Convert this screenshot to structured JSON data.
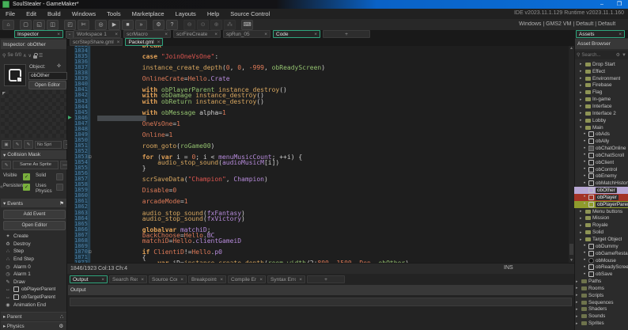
{
  "window": {
    "title": "SoulStealer - GameMaker*",
    "minimize": "–",
    "maximize": "❐"
  },
  "menu": {
    "items": [
      "File",
      "Edit",
      "Build",
      "Windows",
      "Tools",
      "Marketplace",
      "Layouts",
      "Help",
      "Source Control"
    ],
    "version_text": "IDE v2023.11.1.129 Runtime v2023.11.1.160"
  },
  "toolbar": {
    "target_text": "Windows | GMS2 VM | Default | Default",
    "glyphs": {
      "home": "⌂",
      "new": "▢",
      "open": "◱",
      "save": "◫",
      "package": "◰",
      "clean": "✄",
      "debug": "◎",
      "run": "▶",
      "stop": "■",
      "forward": "»",
      "settings": "⚙",
      "help": "?",
      "zoom-out": "⊖",
      "zoom-reset": "⊙",
      "zoom-in": "⊕",
      "paw": "⁂",
      "laptop": "⌨"
    },
    "groups": [
      {
        "dim": false,
        "icons": [
          "home"
        ]
      },
      {
        "dim": false,
        "icons": [
          "new",
          "open",
          "save"
        ]
      },
      {
        "dim": false,
        "icons": [
          "package",
          "clean"
        ]
      },
      {
        "dim": false,
        "icons": [
          "debug",
          "run",
          "stop",
          "forward"
        ]
      },
      {
        "dim": false,
        "icons": [
          "settings",
          "help"
        ]
      },
      {
        "dim": true,
        "icons": [
          "zoom-out",
          "zoom-reset",
          "zoom-in",
          "paw"
        ]
      },
      {
        "dim": false,
        "icons": [
          "laptop"
        ]
      }
    ]
  },
  "workspace_tabs": [
    {
      "label": "Workspace 1",
      "active": false
    },
    {
      "label": "scrMacro",
      "active": false
    },
    {
      "label": "scrFireCreate",
      "active": false
    },
    {
      "label": "spRun_05",
      "active": false
    },
    {
      "label": "Code",
      "active": true
    }
  ],
  "inspector": {
    "tab_label": "Inspector",
    "header": "Inspector: obOther",
    "search": {
      "icon": "⚲",
      "label": "Se",
      "count": "0/0",
      "up": "∧",
      "down": "∨",
      "menu": "☰"
    },
    "object": {
      "label": "Object:",
      "pin": "✜",
      "name": "obOther",
      "open_editor": "Open Editor"
    },
    "sprite_row": {
      "value": "No Spri",
      "more": "—"
    },
    "collision": {
      "title": "Collision Mask",
      "edit": "✎",
      "same_as": "Same As Sprite",
      "more": "—",
      "checkboxes": [
        {
          "label": "Visible",
          "checked": true
        },
        {
          "label": "Solid",
          "checked": false
        },
        {
          "label": "Persistent",
          "checked": true
        },
        {
          "label": "Uses Physics",
          "checked": false
        }
      ]
    },
    "events": {
      "title": "Events",
      "flag": "⚑",
      "add_button": "Add Event",
      "open_button": "Open Editor",
      "glyphs": {
        "create": "✦",
        "destroy": "♻",
        "step": "∴",
        "alarm": "◷",
        "draw": "✎",
        "collision": "↔",
        "animend": "◉"
      },
      "list": [
        {
          "icon": "create",
          "label": "Create"
        },
        {
          "icon": "destroy",
          "label": "Destroy"
        },
        {
          "icon": "step",
          "label": "Step"
        },
        {
          "icon": "step",
          "label": "End Step"
        },
        {
          "icon": "alarm",
          "label": "Alarm 0"
        },
        {
          "icon": "alarm",
          "label": "Alarm 1"
        },
        {
          "icon": "draw",
          "label": "Draw"
        },
        {
          "icon": "collision",
          "label": "obPlayerParent",
          "obj": true
        },
        {
          "icon": "collision",
          "label": "obTargetParent",
          "obj": true
        },
        {
          "icon": "animend",
          "label": "Animation End"
        }
      ]
    },
    "sections": [
      {
        "label": "Parent",
        "icon": "∴"
      },
      {
        "label": "Physics",
        "icon": "⚙"
      }
    ],
    "collapse_glyph": "«"
  },
  "editor": {
    "file_tabs": [
      {
        "label": "scrStepShare.gml",
        "active": false
      },
      {
        "label": "Packet.gml",
        "active": true
      }
    ],
    "status_left": "1846/1923 Col:13 Ch:4",
    "status_right": "INS",
    "exec_marker": "▶",
    "fold_glyph": "⊟",
    "lines": [
      {
        "n": "1833",
        "seg": [
          [
            "k",
            "            break"
          ]
        ]
      },
      {
        "n": "1834",
        "seg": []
      },
      {
        "n": "1835",
        "seg": [
          [
            "k",
            "            case "
          ],
          [
            "s",
            "\"JoinOneVsOne\""
          ],
          [
            "w",
            ":"
          ]
        ]
      },
      {
        "n": "1836",
        "seg": []
      },
      {
        "n": "1837",
        "seg": [
          [
            "f",
            "            instance_create_depth"
          ],
          [
            "w",
            "("
          ],
          [
            "n",
            "0"
          ],
          [
            "w",
            ", "
          ],
          [
            "n",
            "0"
          ],
          [
            "w",
            ", "
          ],
          [
            "n",
            "-999"
          ],
          [
            "w",
            ", "
          ],
          [
            "o",
            "obReadyScreen"
          ],
          [
            "w",
            ")"
          ]
        ]
      },
      {
        "n": "1838",
        "seg": []
      },
      {
        "n": "1839",
        "seg": [
          [
            "g",
            "            OnlineCrate"
          ],
          [
            "w",
            "="
          ],
          [
            "g",
            "Hello"
          ],
          [
            "w",
            "."
          ],
          [
            "v",
            "Crate"
          ]
        ]
      },
      {
        "n": "1840",
        "seg": []
      },
      {
        "n": "1841",
        "seg": [
          [
            "k",
            "            with "
          ],
          [
            "o",
            "obPlayerParent"
          ],
          [
            "w",
            " "
          ],
          [
            "f",
            "instance_destroy"
          ],
          [
            "w",
            "()"
          ]
        ]
      },
      {
        "n": "1842",
        "seg": [
          [
            "k",
            "            with "
          ],
          [
            "o",
            "obDamage"
          ],
          [
            "w",
            " "
          ],
          [
            "f",
            "instance_destroy"
          ],
          [
            "w",
            "()"
          ]
        ]
      },
      {
        "n": "1843",
        "seg": [
          [
            "k",
            "            with "
          ],
          [
            "o",
            "obReturn"
          ],
          [
            "w",
            " "
          ],
          [
            "f",
            "instance_destroy"
          ],
          [
            "w",
            "()"
          ]
        ]
      },
      {
        "n": "1844",
        "seg": []
      },
      {
        "n": "1845",
        "seg": [
          [
            "k",
            "            with "
          ],
          [
            "o",
            "obMessage"
          ],
          [
            "w",
            " alpha="
          ],
          [
            "n",
            "1"
          ]
        ]
      },
      {
        "n": "1846",
        "caret": true,
        "seg": []
      },
      {
        "n": "1847",
        "seg": [
          [
            "g",
            "            OneVsOne"
          ],
          [
            "w",
            "="
          ],
          [
            "n",
            "1"
          ]
        ]
      },
      {
        "n": "1848",
        "seg": []
      },
      {
        "n": "1849",
        "seg": [
          [
            "g",
            "            Online"
          ],
          [
            "w",
            "="
          ],
          [
            "n",
            "1"
          ]
        ]
      },
      {
        "n": "1850",
        "seg": []
      },
      {
        "n": "1851",
        "seg": [
          [
            "f",
            "            room_goto"
          ],
          [
            "w",
            "("
          ],
          [
            "o",
            "roGame00"
          ],
          [
            "w",
            ")"
          ]
        ]
      },
      {
        "n": "1852",
        "seg": []
      },
      {
        "n": "1853",
        "fold": true,
        "seg": [
          [
            "k",
            "            for "
          ],
          [
            "w",
            "("
          ],
          [
            "k",
            "var"
          ],
          [
            "w",
            " i = "
          ],
          [
            "n",
            "0"
          ],
          [
            "w",
            "; i < "
          ],
          [
            "v",
            "menuMusicCount"
          ],
          [
            "w",
            "; ++i) {"
          ]
        ]
      },
      {
        "n": "1854",
        "seg": [
          [
            "f",
            "                audio_stop_sound"
          ],
          [
            "w",
            "("
          ],
          [
            "v",
            "audioMusicM"
          ],
          [
            "w",
            "[i])"
          ]
        ]
      },
      {
        "n": "1855",
        "seg": [
          [
            "w",
            "            }"
          ]
        ]
      },
      {
        "n": "1856",
        "seg": []
      },
      {
        "n": "1857",
        "seg": [
          [
            "f",
            "            scrSaveData"
          ],
          [
            "w",
            "("
          ],
          [
            "s",
            "\"Champion\""
          ],
          [
            "w",
            ", "
          ],
          [
            "v",
            "Champion"
          ],
          [
            "w",
            ")"
          ]
        ]
      },
      {
        "n": "1858",
        "seg": []
      },
      {
        "n": "1859",
        "seg": [
          [
            "g",
            "            Disable"
          ],
          [
            "w",
            "="
          ],
          [
            "n",
            "0"
          ]
        ]
      },
      {
        "n": "1860",
        "seg": []
      },
      {
        "n": "1861",
        "seg": [
          [
            "g",
            "            arcadeMode"
          ],
          [
            "w",
            "="
          ],
          [
            "n",
            "1"
          ]
        ]
      },
      {
        "n": "1862",
        "seg": []
      },
      {
        "n": "1863",
        "seg": [
          [
            "f",
            "            audio_stop_sound"
          ],
          [
            "w",
            "("
          ],
          [
            "v",
            "fxFantasy"
          ],
          [
            "w",
            ")"
          ]
        ]
      },
      {
        "n": "1864",
        "seg": [
          [
            "f",
            "            audio_stop_sound"
          ],
          [
            "w",
            "("
          ],
          [
            "v",
            "fxVictory"
          ],
          [
            "w",
            ")"
          ]
        ]
      },
      {
        "n": "1865",
        "seg": []
      },
      {
        "n": "1866",
        "seg": [
          [
            "k",
            "            globalvar "
          ],
          [
            "v",
            "matchiD"
          ],
          [
            "w",
            ";"
          ]
        ]
      },
      {
        "n": "1867",
        "seg": [
          [
            "g",
            "            backChoose"
          ],
          [
            "w",
            "="
          ],
          [
            "g",
            "Hello"
          ],
          [
            "w",
            "."
          ],
          [
            "v",
            "BC"
          ]
        ]
      },
      {
        "n": "1868",
        "seg": [
          [
            "g",
            "            matchiD"
          ],
          [
            "w",
            "="
          ],
          [
            "g",
            "Hello"
          ],
          [
            "w",
            "."
          ],
          [
            "v",
            "clientGameiD"
          ]
        ]
      },
      {
        "n": "1869",
        "seg": []
      },
      {
        "n": "1870",
        "fold": true,
        "seg": [
          [
            "k",
            "            if "
          ],
          [
            "g",
            "ClientiD"
          ],
          [
            "w",
            "!="
          ],
          [
            "g",
            "Hello"
          ],
          [
            "w",
            "."
          ],
          [
            "v",
            "p0"
          ]
        ]
      },
      {
        "n": "1871",
        "seg": [
          [
            "w",
            "            {"
          ]
        ]
      },
      {
        "n": "1872",
        "seg": [
          [
            "k",
            "                var "
          ],
          [
            "w",
            "iD="
          ],
          [
            "f",
            "instance_create_depth"
          ],
          [
            "w",
            "("
          ],
          [
            "o",
            "room_width"
          ],
          [
            "w",
            "/2+"
          ],
          [
            "n",
            "800"
          ],
          [
            "w",
            ", "
          ],
          [
            "n",
            "1500"
          ],
          [
            "w",
            ", "
          ],
          [
            "g",
            "Dep"
          ],
          [
            "w",
            ", "
          ],
          [
            "o",
            "obOther"
          ],
          [
            "w",
            ")"
          ]
        ]
      }
    ]
  },
  "output": {
    "tabs": [
      {
        "label": "Output",
        "active": true
      },
      {
        "label": "Search Results",
        "active": false
      },
      {
        "label": "Source Control",
        "active": false
      },
      {
        "label": "Breakpoints",
        "active": false
      },
      {
        "label": "Compile Errors",
        "active": false
      },
      {
        "label": "Syntax Errors",
        "active": false
      }
    ],
    "header": "Output"
  },
  "assets": {
    "tab_label": "Assets",
    "header": "Asset Browser",
    "search": {
      "icon": "⚲",
      "placeholder": "Search...",
      "gear": "⚙",
      "filter": "▼"
    },
    "tree": [
      {
        "label": "Drop Start",
        "ind": 1,
        "type": "folder",
        "arrow": "▸"
      },
      {
        "label": "Effect",
        "ind": 1,
        "type": "folder",
        "arrow": "▸"
      },
      {
        "label": "Environment",
        "ind": 1,
        "type": "folder",
        "arrow": "▸"
      },
      {
        "label": "Firebase",
        "ind": 1,
        "type": "folder",
        "arrow": "▸"
      },
      {
        "label": "Flag",
        "ind": 1,
        "type": "folder",
        "arrow": "▸"
      },
      {
        "label": "In-game",
        "ind": 1,
        "type": "folder",
        "arrow": "▸"
      },
      {
        "label": "Interface",
        "ind": 1,
        "type": "folder",
        "arrow": "▸"
      },
      {
        "label": "Interface 2",
        "ind": 1,
        "type": "folder",
        "arrow": "▸"
      },
      {
        "label": "Lobby",
        "ind": 1,
        "type": "folder",
        "arrow": "▸"
      },
      {
        "label": "Main",
        "ind": 1,
        "type": "folder",
        "arrow": "▾"
      },
      {
        "label": "obAds",
        "ind": 2,
        "type": "obj",
        "bullet": true
      },
      {
        "label": "obAlly",
        "ind": 2,
        "type": "obj",
        "bullet": true
      },
      {
        "label": "obChatOnline",
        "ind": 2,
        "type": "script",
        "bullet": true
      },
      {
        "label": "obChatScroll",
        "ind": 2,
        "type": "obj",
        "bullet": true
      },
      {
        "label": "obClient",
        "ind": 2,
        "type": "obj",
        "bullet": true
      },
      {
        "label": "obControl",
        "ind": 2,
        "type": "obj",
        "bullet": true
      },
      {
        "label": "obEnemy",
        "ind": 2,
        "type": "obj",
        "bullet": true
      },
      {
        "label": "obMatchHistory",
        "ind": 2,
        "type": "obj",
        "bullet": true
      },
      {
        "label": "obOther",
        "ind": 2,
        "type": "obj",
        "bullet": true,
        "hl": "purple"
      },
      {
        "label": "obPlayer",
        "ind": 2,
        "type": "obj",
        "bullet": true,
        "hl": "red"
      },
      {
        "label": "obPlayerParent",
        "ind": 2,
        "type": "obj",
        "bullet": true,
        "hl": "olive"
      },
      {
        "label": "Menu buttons",
        "ind": 1,
        "type": "folder",
        "arrow": "▸"
      },
      {
        "label": "Mission",
        "ind": 1,
        "type": "folder",
        "arrow": "▸"
      },
      {
        "label": "Royale",
        "ind": 1,
        "type": "folder",
        "arrow": "▸"
      },
      {
        "label": "Solid",
        "ind": 1,
        "type": "folder",
        "arrow": "▸"
      },
      {
        "label": "Target Object",
        "ind": 1,
        "type": "folder",
        "arrow": "▸"
      },
      {
        "label": "obDummy",
        "ind": 2,
        "type": "obj",
        "bullet": true
      },
      {
        "label": "obGameRestart",
        "ind": 2,
        "type": "obj",
        "bullet": true
      },
      {
        "label": "obMouse",
        "ind": 2,
        "type": "mouse",
        "bullet": true
      },
      {
        "label": "obReadyScreen",
        "ind": 2,
        "type": "obj",
        "bullet": true
      },
      {
        "label": "obSave",
        "ind": 2,
        "type": "obj",
        "bullet": true
      },
      {
        "label": "Paths",
        "ind": 0,
        "type": "folder-dim",
        "arrow": "▸"
      },
      {
        "label": "Rooms",
        "ind": 0,
        "type": "folder-dim",
        "arrow": "▸"
      },
      {
        "label": "Scripts",
        "ind": 0,
        "type": "folder-dim",
        "arrow": "▸"
      },
      {
        "label": "Sequences",
        "ind": 0,
        "type": "folder-dim",
        "arrow": "▸"
      },
      {
        "label": "Shaders",
        "ind": 0,
        "type": "folder-dim",
        "arrow": "▸"
      },
      {
        "label": "Sounds",
        "ind": 0,
        "type": "folder-dim",
        "arrow": "▸"
      },
      {
        "label": "Sprites",
        "ind": 0,
        "type": "folder-dim",
        "arrow": "▸"
      }
    ]
  }
}
